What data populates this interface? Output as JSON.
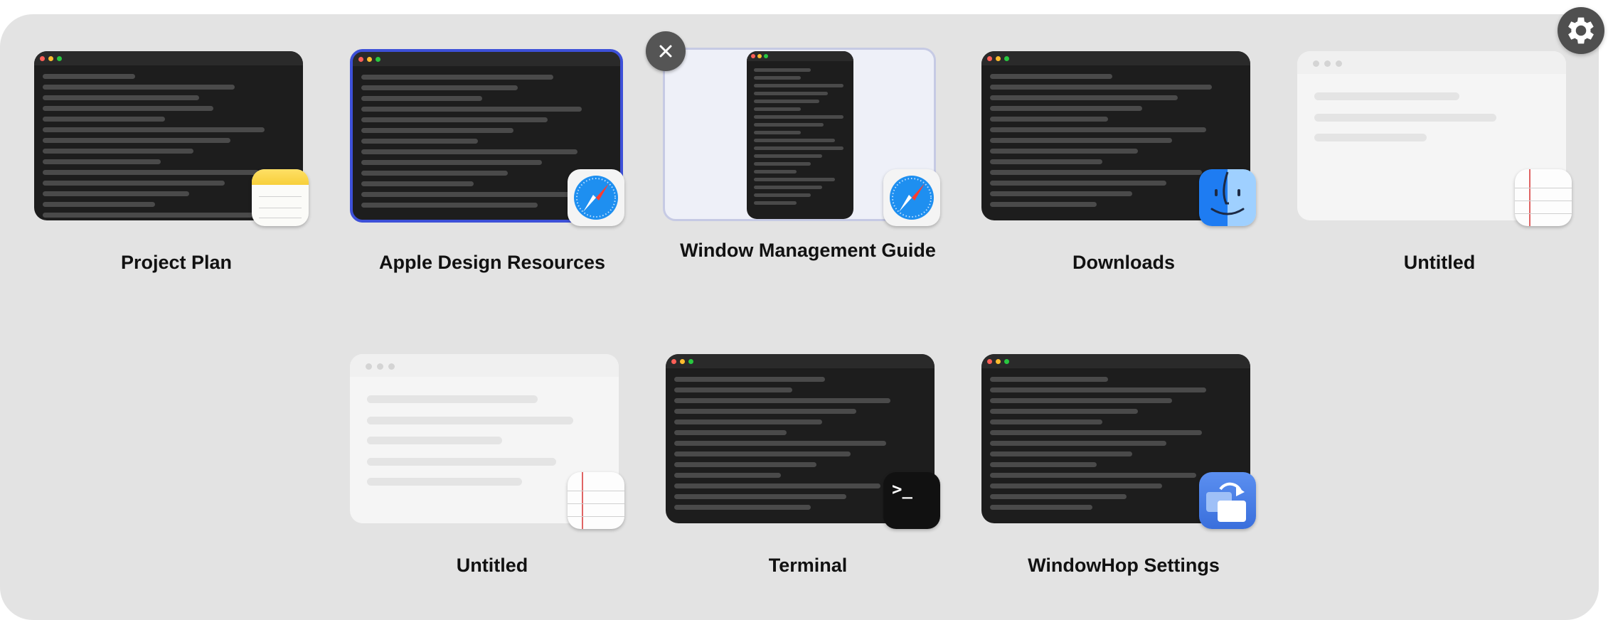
{
  "windows": [
    {
      "title": "Project Plan",
      "app": "Notes",
      "icon": "notes-icon"
    },
    {
      "title": "Apple Design Resources",
      "app": "Safari",
      "icon": "safari-icon"
    },
    {
      "title": "Window Management Guide",
      "app": "Safari",
      "icon": "safari-icon"
    },
    {
      "title": "Downloads",
      "app": "Finder",
      "icon": "finder-icon"
    },
    {
      "title": "Untitled",
      "app": "TextEdit",
      "icon": "textedit-icon"
    },
    {
      "title": "Untitled",
      "app": "TextEdit",
      "icon": "textedit-icon"
    },
    {
      "title": "Terminal",
      "app": "Terminal",
      "icon": "terminal-icon"
    },
    {
      "title": "WindowHop Settings",
      "app": "WindowHop",
      "icon": "windowhop-icon"
    }
  ],
  "terminal_prompt": ">_",
  "colors": {
    "accent": "#3d50d8",
    "panel": "#e3e3e3"
  }
}
